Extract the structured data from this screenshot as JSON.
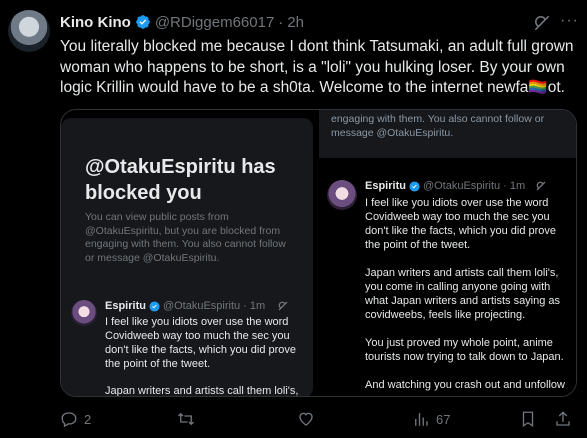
{
  "tweet": {
    "author_name": "Kino Kino",
    "handle": "@RDiggem66017",
    "separator": "·",
    "time": "2h",
    "more": "···",
    "text": "You literally blocked me because I dont think Tatsumaki, an adult full grown woman who happens to be short, is a \"loli\" you hulking loser. By your own logic Krillin would have to be a sh0ta. Welcome to the internet newfa🏳️‍🌈ot."
  },
  "left_panel": {
    "title": "@OtakuEspiritu has blocked you",
    "body": "You can view public posts from @OtakuEspiritu, but you are blocked from engaging with them. You also cannot follow or message @OtakuEspiritu.",
    "quoted": {
      "name": "Espiritu",
      "handle": "@OtakuEspiritu",
      "separator": "·",
      "time": "1m",
      "text_1": "I feel like you idiots over use the word Covidweeb way too much the sec you don't like the facts, which you did prove the point of the tweet.",
      "text_2": "Japan writers and artists call them loli's,"
    }
  },
  "right_panel": {
    "top_text": "engaging with them. You also cannot follow or message @OtakuEspiritu.",
    "quoted": {
      "name": "Espiritu",
      "handle": "@OtakuEspiritu",
      "separator": "·",
      "time": "1m",
      "para_1": "I feel like you idiots over use the word Covidweeb way too much the sec you don't like the facts, which you did prove the point of the tweet.",
      "para_2": "Japan writers and artists call them loli's, you come in calling anyone going with what Japan writers and artists saying as covidweebs, feels like projecting.",
      "para_3": "You just proved my whole point, anime tourists now trying to talk down to Japan.",
      "para_4": "And watching you crash out and unfollow"
    }
  },
  "actions": {
    "replies": "2",
    "views": "67"
  },
  "colors": {
    "background": "#000000",
    "text": "#e7e9ea",
    "muted": "#71767b",
    "verified": "#1d9bf0",
    "card": "#16181c"
  }
}
